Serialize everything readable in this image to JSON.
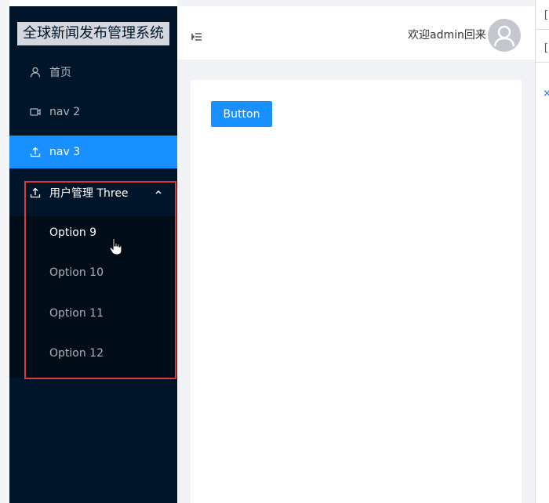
{
  "app": {
    "title": "全球新闻发布管理系统"
  },
  "sidebar": {
    "items": [
      {
        "label": "首页",
        "icon": "user-icon"
      },
      {
        "label": "nav 2",
        "icon": "video-camera-icon"
      },
      {
        "label": "nav 3",
        "icon": "upload-icon",
        "active": true
      },
      {
        "label": "用户管理 Three",
        "icon": "upload-icon",
        "expanded": true
      }
    ],
    "submenu": [
      {
        "label": "Option 9"
      },
      {
        "label": "Option 10"
      },
      {
        "label": "Option 11"
      },
      {
        "label": "Option 12"
      }
    ]
  },
  "header": {
    "welcome": "欢迎admin回来",
    "fold_icon": "menu-fold-icon",
    "avatar_icon": "user-avatar-icon"
  },
  "main": {
    "button_label": "Button"
  },
  "colors": {
    "sidebar_bg": "#001529",
    "submenu_bg": "#000c17",
    "primary": "#1890ff",
    "highlight_border": "#e5363a"
  }
}
